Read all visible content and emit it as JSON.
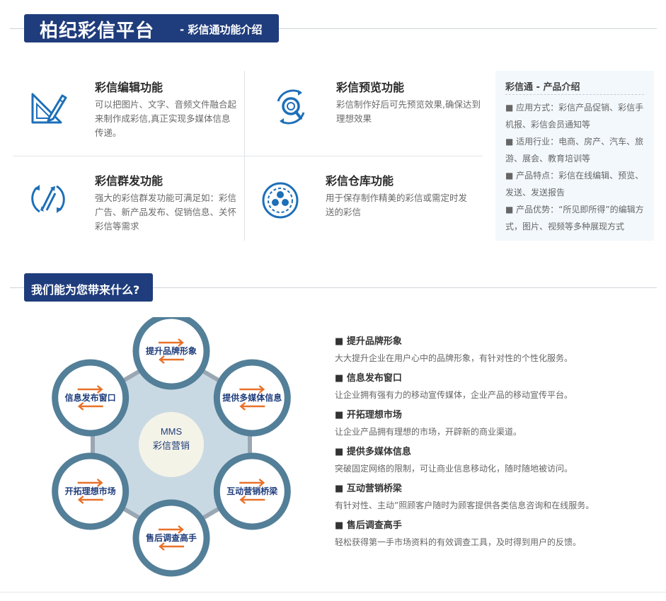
{
  "header": {
    "title": "柏纪彩信平台",
    "subtitle": "- 彩信通功能介绍"
  },
  "features": [
    {
      "title": "彩信编辑功能",
      "desc": "可以把图片、文字、音频文件融合起来制作成彩信,真正实现多媒体信息传递。",
      "icon": "edit-pencil-icon"
    },
    {
      "title": "彩信预览功能",
      "desc": "彩信制作好后可先预览效果,确保达到理想效果",
      "icon": "preview-search-icon"
    },
    {
      "title": "彩信群发功能",
      "desc": "强大的彩信群发功能可满足如：彩信广告、新产品发布、促销信息、关怀彩信等需求",
      "icon": "mass-send-icon"
    },
    {
      "title": "彩信仓库功能",
      "desc": "用于保存制作精美的彩信或需定时发送的彩信",
      "icon": "warehouse-icon"
    }
  ],
  "intro": {
    "title": "彩信通 - 产品介绍",
    "items": [
      "■ 应用方式：彩信产品促销、彩信手机报、彩信会员通知等",
      "■ 适用行业：电商、房产、汽车、旅游、展会、教育培训等",
      "■ 产品特点：彩信在线编辑、预览、发送、发送报告",
      "■ 产品优势：“所见即所得”的编辑方式，图片、视频等多种展现方式"
    ]
  },
  "section2": {
    "title": "我们能为您带来什么?"
  },
  "diagram": {
    "center_line1": "MMS",
    "center_line2": "彩信营销",
    "nodes": [
      "提升品牌形象",
      "提供多媒体信息",
      "互动营销桥梁",
      "售后调查高手",
      "开拓理想市场",
      "信息发布窗口"
    ],
    "colors": {
      "ring": "#537f98",
      "hub": "#c9d9e3",
      "arrow": "#e8712a",
      "label": "#1f3d7c"
    }
  },
  "benefits": [
    {
      "title": "提升品牌形象",
      "desc": "大大提升企业在用户心中的品牌形象，有针对性的个性化服务。"
    },
    {
      "title": "信息发布窗口",
      "desc": "让企业拥有强有力的移动宣传媒体，企业产品的移动宣传平台。"
    },
    {
      "title": "开拓理想市场",
      "desc": "让企业产品拥有理想的市场，开辟新的商业渠道。"
    },
    {
      "title": "提供多媒体信息",
      "desc": "突破固定网络的限制，可让商业信息移动化，随时随地被访问。"
    },
    {
      "title": "互动营销桥梁",
      "desc": "有针对性、主动”照顾客户随时为顾客提供各类信息咨询和在线服务。"
    },
    {
      "title": "售后调查高手",
      "desc": "轻松获得第一手市场资料的有效调查工具，及时得到用户的反馈。"
    }
  ],
  "benefit_bullet": "■",
  "colors": {
    "brand": "#1f3d7c",
    "icon_blue": "#1d6fb8"
  }
}
